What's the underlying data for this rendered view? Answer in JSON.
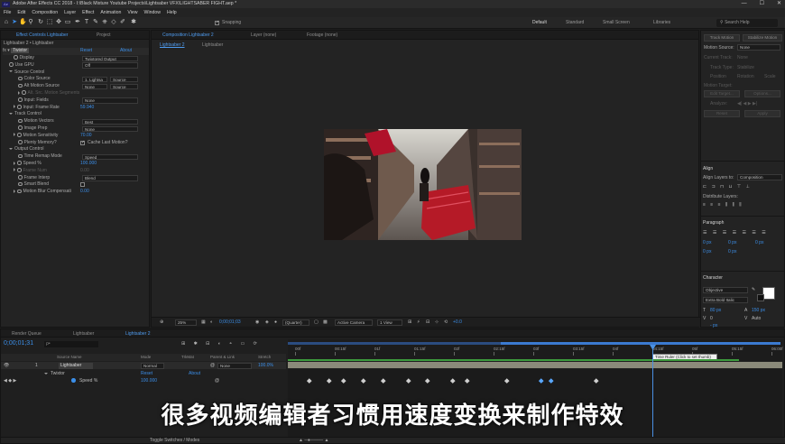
{
  "window": {
    "title": "Adobe After Effects CC 2018 - I:\\Black Mixture Youtube Projects\\Lightsaber VFX\\LIGHTSABER FIGHT.aep *",
    "logo": "Ae",
    "controls": [
      "—",
      "☐",
      "✕"
    ]
  },
  "menu": [
    "File",
    "Edit",
    "Composition",
    "Layer",
    "Effect",
    "Animation",
    "View",
    "Window",
    "Help"
  ],
  "toolbar": {
    "snapping": "Snapping",
    "workspaces": [
      "Default",
      "Standard",
      "Small Screen",
      "Libraries"
    ],
    "workspace_active": "Default",
    "search_placeholder": "Search Help"
  },
  "effect_panel": {
    "tabs": [
      "Effect Controls Lightsaber",
      "Project"
    ],
    "layer_title": "Lightsaber 2 • Lightsaber",
    "fx_name": "Twixtor",
    "reset": "Reset",
    "about": "About",
    "rows": [
      {
        "label": "Display",
        "value": "Twixtored Output",
        "type": "dd",
        "indent": 2
      },
      {
        "label": "Use GPU",
        "value": "Off",
        "type": "dd",
        "indent": 1
      },
      {
        "label": "Source Control",
        "value": "",
        "type": "group",
        "indent": 1
      },
      {
        "label": "Color Source",
        "value": "1. Lightsa",
        "value2": "Source",
        "type": "dd2",
        "indent": 3
      },
      {
        "label": "Alt Motion Source",
        "value": "None",
        "value2": "Source",
        "type": "dd2",
        "indent": 3
      },
      {
        "label": "Alt. Src. Motion Segments",
        "value": "",
        "type": "dim",
        "indent": 3
      },
      {
        "label": "Input: Fields",
        "value": "None",
        "type": "dd",
        "indent": 3
      },
      {
        "label": "Input: Frame Rate",
        "value": "59.940",
        "type": "blue",
        "indent": 2
      },
      {
        "label": "Track Control",
        "value": "",
        "type": "group",
        "indent": 1
      },
      {
        "label": "Motion Vectors",
        "value": "Best",
        "type": "dd",
        "indent": 3
      },
      {
        "label": "Image Prep",
        "value": "None",
        "type": "dd",
        "indent": 3
      },
      {
        "label": "Motion Sensitivity",
        "value": "70.00",
        "type": "blue",
        "indent": 2
      },
      {
        "label": "Plenty Memory?",
        "value": "Cache Last Motion?",
        "type": "check",
        "indent": 3
      },
      {
        "label": "Output Control",
        "value": "",
        "type": "group",
        "indent": 1
      },
      {
        "label": "Time Remap Mode",
        "value": "Speed",
        "type": "dd",
        "indent": 3
      },
      {
        "label": "Speed %",
        "value": "100.000",
        "type": "blue",
        "indent": 2
      },
      {
        "label": "Frame Num",
        "value": "0.00",
        "type": "dim",
        "indent": 2
      },
      {
        "label": "Frame Interp",
        "value": "Blend",
        "type": "dd",
        "indent": 3
      },
      {
        "label": "Smart Blend",
        "value": "",
        "type": "check",
        "indent": 3
      },
      {
        "label": "Motion Blur Compensati",
        "value": "0.00",
        "type": "blue",
        "indent": 2
      }
    ]
  },
  "comp_panel": {
    "tabs": [
      "Composition Lightsaber 2",
      "Layer (none)",
      "Footage (none)"
    ],
    "subtab": "Lightsaber 2",
    "subtab2": "Lightsaber",
    "bottom": {
      "zoom": "25%",
      "timecode": "0;00;01;03",
      "resolution": "(Quarter)",
      "camera": "Active Camera",
      "view": "1 View",
      "exposure": "+0.0"
    }
  },
  "tracker_panel": {
    "buttons": [
      "Track Motion",
      "Stabilize Motion"
    ],
    "motion_source_label": "Motion Source:",
    "motion_source": "None",
    "current_track_label": "Current Track:",
    "current_track": "None",
    "track_type_label": "Track Type:",
    "track_type": "Stabilize",
    "checks": [
      "Position",
      "Rotation",
      "Scale"
    ],
    "motion_target": "Motion Target:",
    "edit_target": "Edit Target...",
    "options": "Options...",
    "analyze": "Analyze:",
    "reset": "Reset",
    "apply": "Apply"
  },
  "align_panel": {
    "title": "Align",
    "align_layers_to": "Align Layers to:",
    "align_to_value": "Composition",
    "distribute": "Distribute Layers:"
  },
  "paragraph_panel": {
    "title": "Paragraph",
    "fields": [
      "0 px",
      "0 px",
      "0 px",
      "0 px",
      "0 px"
    ]
  },
  "character_panel": {
    "title": "Character",
    "font": "Objective",
    "style": "Extra Bold Italic",
    "size": "80 px",
    "leading": "150 px",
    "tracking": "Auto",
    "kerning": "0",
    "stroke": "- px"
  },
  "timeline": {
    "tabs": [
      "Render Queue",
      "Lightsaber",
      "Lightsaber 2"
    ],
    "timecode": "0;00;01;31",
    "search_placeholder": "ρ•",
    "headers": [
      "Source Name",
      "Mode",
      "TrkMat",
      "Parent & Link",
      "Stretch"
    ],
    "layer": {
      "index": "1",
      "name": "Lightsaber",
      "mode": "Normal",
      "parent": "None",
      "stretch": "100.0%"
    },
    "effect_row": {
      "name": "Twixtor",
      "reset": "Reset",
      "about": "About"
    },
    "speed_row": {
      "name": "Speed %",
      "value": "100.000"
    },
    "ruler": [
      "00f",
      "00:15f",
      "01f",
      "01:15f",
      "02f",
      "02:15f",
      "03f",
      "03:15f",
      "04f",
      "04:15f",
      "05f",
      "05:15f",
      "06:00f"
    ],
    "tooltip": "Time Ruler (Click to set thumb)",
    "footer": "Toggle Switches / Modes",
    "keyframes": [
      4,
      8,
      11,
      15,
      19,
      24,
      28,
      33,
      36,
      44,
      51,
      53,
      62
    ]
  },
  "subtitle": "很多视频编辑者习惯用速度变换来制作特效",
  "colors": {
    "accent": "#3b8ee8",
    "bg": "#1d1d1d",
    "panel": "#232323",
    "layer_bar": "#8b8a7a"
  }
}
